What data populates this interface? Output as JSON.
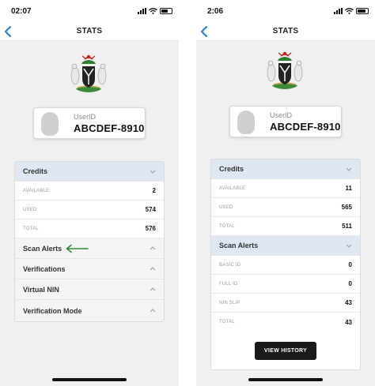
{
  "colors": {
    "accent": "#2979c9",
    "section_highlight": "#dfe7f2",
    "arrow": "#2e8b3a",
    "button": "#1a1a1a"
  },
  "left": {
    "status": {
      "time": "02:07"
    },
    "nav": {
      "title": "STATS",
      "back_icon": "chevron-left-icon"
    },
    "user": {
      "label": "UserID",
      "value": "ABCDEF-8910"
    },
    "credits": {
      "label": "Credits",
      "rows": [
        {
          "label": "AVAILABLE",
          "value": "2"
        },
        {
          "label": "USED",
          "value": "574"
        },
        {
          "label": "TOTAL",
          "value": "576"
        }
      ]
    },
    "sections": [
      {
        "label": "Scan Alerts"
      },
      {
        "label": "Verifications"
      },
      {
        "label": "Virtual NIN"
      },
      {
        "label": "Verification Mode"
      }
    ]
  },
  "right": {
    "status": {
      "time": "2:06"
    },
    "nav": {
      "title": "STATS",
      "back_icon": "chevron-left-icon"
    },
    "user": {
      "label": "UserID",
      "value": "ABCDEF-8910"
    },
    "credits": {
      "label": "Credits",
      "rows": [
        {
          "label": "AVAILABLE",
          "value": "11"
        },
        {
          "label": "USED",
          "value": "565"
        },
        {
          "label": "TOTAL",
          "value": "511"
        }
      ]
    },
    "scan_alerts": {
      "label": "Scan Alerts",
      "rows": [
        {
          "label": "BASIC ID",
          "value": "0"
        },
        {
          "label": "FULL ID",
          "value": "0"
        },
        {
          "label": "NIN SLIP",
          "value": "43"
        },
        {
          "label": "TOTAL",
          "value": "43"
        }
      ]
    },
    "button": {
      "label": "VIEW HISTORY"
    }
  }
}
